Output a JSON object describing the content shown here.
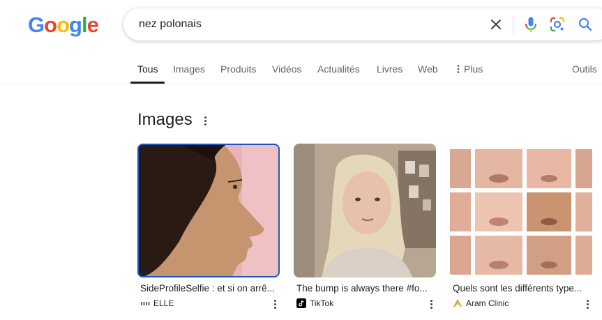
{
  "logo": {
    "letters": [
      "G",
      "o",
      "o",
      "g",
      "l",
      "e"
    ],
    "colors": [
      "#4285F4",
      "#EA4335",
      "#FBBC05",
      "#4285F4",
      "#34A853",
      "#EA4335"
    ]
  },
  "search": {
    "query": "nez polonais"
  },
  "tabs": [
    {
      "label": "Tous",
      "active": true
    },
    {
      "label": "Images"
    },
    {
      "label": "Produits"
    },
    {
      "label": "Vidéos"
    },
    {
      "label": "Actualités"
    },
    {
      "label": "Livres"
    },
    {
      "label": "Web"
    },
    {
      "label": "Plus"
    },
    {
      "label": "Outils"
    }
  ],
  "images_section": {
    "title": "Images",
    "cards": [
      {
        "caption": "SideProfileSelfie : et si on arrê...",
        "source": "ELLE",
        "icon": "elle-logo-icon"
      },
      {
        "caption": "The bump is always there #fo...",
        "source": "TikTok",
        "icon": "tiktok-icon"
      },
      {
        "caption": "Quels sont les différents type...",
        "source": "Aram Clinic",
        "icon": "aram-clinic-icon"
      }
    ]
  },
  "colors": {
    "accent": "#1a73e8",
    "selected_outline": "#1a56c6"
  }
}
